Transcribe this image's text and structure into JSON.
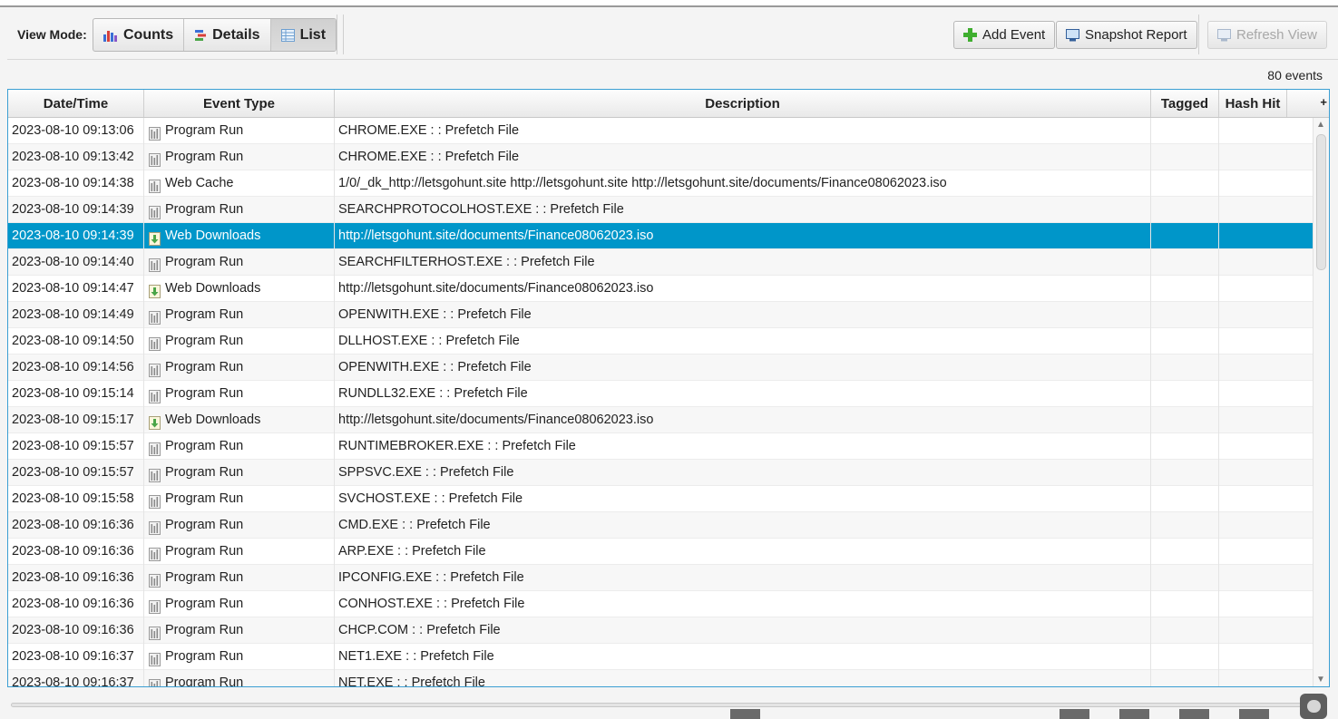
{
  "toolbar": {
    "view_mode_label": "View Mode:",
    "modes": [
      "Counts",
      "Details",
      "List"
    ],
    "active_mode": "List",
    "add_event": "Add Event",
    "snapshot_report": "Snapshot Report",
    "refresh_view": "Refresh View"
  },
  "event_count": "80 events",
  "table": {
    "columns": [
      "Date/Time",
      "Event Type",
      "Description",
      "Tagged",
      "Hash Hit"
    ],
    "selected_index": 4,
    "rows": [
      {
        "dt": "2023-08-10 09:13:06",
        "type": "Program Run",
        "icon": "program-run-icon",
        "desc": "CHROME.EXE :  : Prefetch File"
      },
      {
        "dt": "2023-08-10 09:13:42",
        "type": "Program Run",
        "icon": "program-run-icon",
        "desc": "CHROME.EXE :  : Prefetch File"
      },
      {
        "dt": "2023-08-10 09:14:38",
        "type": "Web Cache",
        "icon": "web-cache-icon",
        "desc": "1/0/_dk_http://letsgohunt.site http://letsgohunt.site http://letsgohunt.site/documents/Finance08062023.iso"
      },
      {
        "dt": "2023-08-10 09:14:39",
        "type": "Program Run",
        "icon": "program-run-icon",
        "desc": "SEARCHPROTOCOLHOST.EXE :  : Prefetch File"
      },
      {
        "dt": "2023-08-10 09:14:39",
        "type": "Web Downloads",
        "icon": "web-download-icon",
        "desc": "http://letsgohunt.site/documents/Finance08062023.iso"
      },
      {
        "dt": "2023-08-10 09:14:40",
        "type": "Program Run",
        "icon": "program-run-icon",
        "desc": "SEARCHFILTERHOST.EXE :  : Prefetch File"
      },
      {
        "dt": "2023-08-10 09:14:47",
        "type": "Web Downloads",
        "icon": "web-download-icon",
        "desc": "http://letsgohunt.site/documents/Finance08062023.iso"
      },
      {
        "dt": "2023-08-10 09:14:49",
        "type": "Program Run",
        "icon": "program-run-icon",
        "desc": "OPENWITH.EXE :  : Prefetch File"
      },
      {
        "dt": "2023-08-10 09:14:50",
        "type": "Program Run",
        "icon": "program-run-icon",
        "desc": "DLLHOST.EXE :  : Prefetch File"
      },
      {
        "dt": "2023-08-10 09:14:56",
        "type": "Program Run",
        "icon": "program-run-icon",
        "desc": "OPENWITH.EXE :  : Prefetch File"
      },
      {
        "dt": "2023-08-10 09:15:14",
        "type": "Program Run",
        "icon": "program-run-icon",
        "desc": "RUNDLL32.EXE :  : Prefetch File"
      },
      {
        "dt": "2023-08-10 09:15:17",
        "type": "Web Downloads",
        "icon": "web-download-icon",
        "desc": "http://letsgohunt.site/documents/Finance08062023.iso"
      },
      {
        "dt": "2023-08-10 09:15:57",
        "type": "Program Run",
        "icon": "program-run-icon",
        "desc": "RUNTIMEBROKER.EXE :  : Prefetch File"
      },
      {
        "dt": "2023-08-10 09:15:57",
        "type": "Program Run",
        "icon": "program-run-icon",
        "desc": "SPPSVC.EXE :  : Prefetch File"
      },
      {
        "dt": "2023-08-10 09:15:58",
        "type": "Program Run",
        "icon": "program-run-icon",
        "desc": "SVCHOST.EXE :  : Prefetch File"
      },
      {
        "dt": "2023-08-10 09:16:36",
        "type": "Program Run",
        "icon": "program-run-icon",
        "desc": "CMD.EXE :  : Prefetch File"
      },
      {
        "dt": "2023-08-10 09:16:36",
        "type": "Program Run",
        "icon": "program-run-icon",
        "desc": "ARP.EXE :  : Prefetch File"
      },
      {
        "dt": "2023-08-10 09:16:36",
        "type": "Program Run",
        "icon": "program-run-icon",
        "desc": "IPCONFIG.EXE :  : Prefetch File"
      },
      {
        "dt": "2023-08-10 09:16:36",
        "type": "Program Run",
        "icon": "program-run-icon",
        "desc": "CONHOST.EXE :  : Prefetch File"
      },
      {
        "dt": "2023-08-10 09:16:36",
        "type": "Program Run",
        "icon": "program-run-icon",
        "desc": "CHCP.COM :  : Prefetch File"
      },
      {
        "dt": "2023-08-10 09:16:37",
        "type": "Program Run",
        "icon": "program-run-icon",
        "desc": "NET1.EXE :  : Prefetch File"
      },
      {
        "dt": "2023-08-10 09:16:37",
        "type": "Program Run",
        "icon": "program-run-icon",
        "desc": "NET.EXE :  : Prefetch File"
      }
    ]
  }
}
